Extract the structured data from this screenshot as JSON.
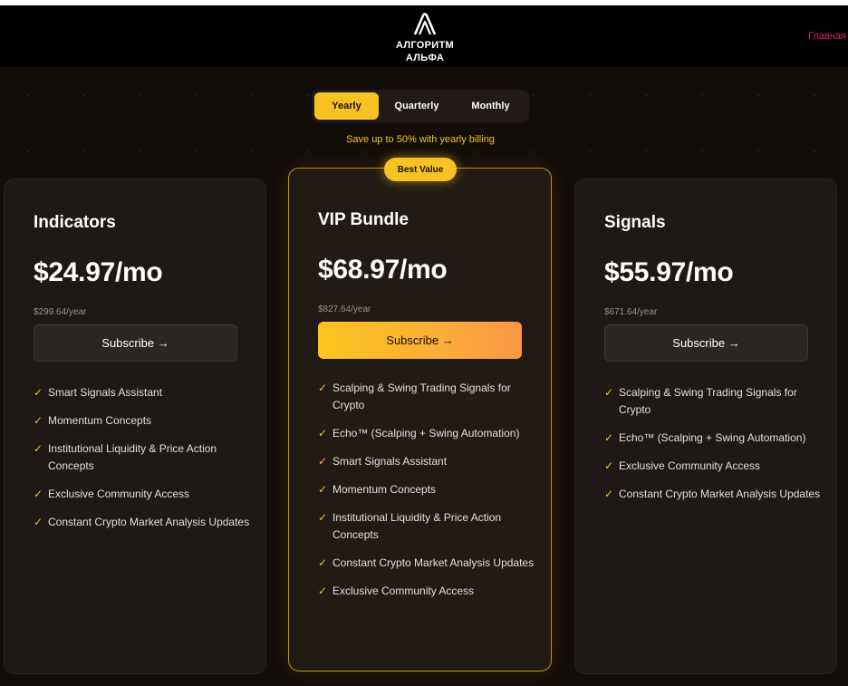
{
  "brand": {
    "name_line1": "АЛГОРИТМ",
    "name_line2": "АЛЬФА"
  },
  "nav": {
    "home_link": "Главная"
  },
  "billing": {
    "options": [
      {
        "label": "Yearly",
        "active": true
      },
      {
        "label": "Quarterly",
        "active": false
      },
      {
        "label": "Monthly",
        "active": false
      }
    ],
    "save_note": "Save up to 50% with yearly billing"
  },
  "plans": [
    {
      "title": "Indicators",
      "price": "$24.97/mo",
      "yearly": "$299.64/year",
      "cta": "Subscribe →",
      "features": [
        "Smart Signals Assistant",
        "Momentum Concepts",
        "Institutional Liquidity & Price Action Concepts",
        "Exclusive Community Access",
        "Constant Crypto Market Analysis Updates"
      ]
    },
    {
      "title": "VIP Bundle",
      "badge": "Best Value",
      "price": "$68.97/mo",
      "yearly": "$827.64/year",
      "cta": "Subscribe →",
      "features": [
        "Scalping & Swing Trading Signals for Crypto",
        "Echo™ (Scalping + Swing Automation)",
        "Smart Signals Assistant",
        "Momentum Concepts",
        "Institutional Liquidity & Price Action Concepts",
        "Constant Crypto Market Analysis Updates",
        "Exclusive Community Access"
      ]
    },
    {
      "title": "Signals",
      "price": "$55.97/mo",
      "yearly": "$671.64/year",
      "cta": "Subscribe →",
      "features": [
        "Scalping & Swing Trading Signals for Crypto",
        "Echo™ (Scalping + Swing Automation)",
        "Exclusive Community Access",
        "Constant Crypto Market Analysis Updates"
      ]
    }
  ],
  "colors": {
    "accent": "#f7c324",
    "background": "#140e0b",
    "nav_link": "#e0285a"
  }
}
